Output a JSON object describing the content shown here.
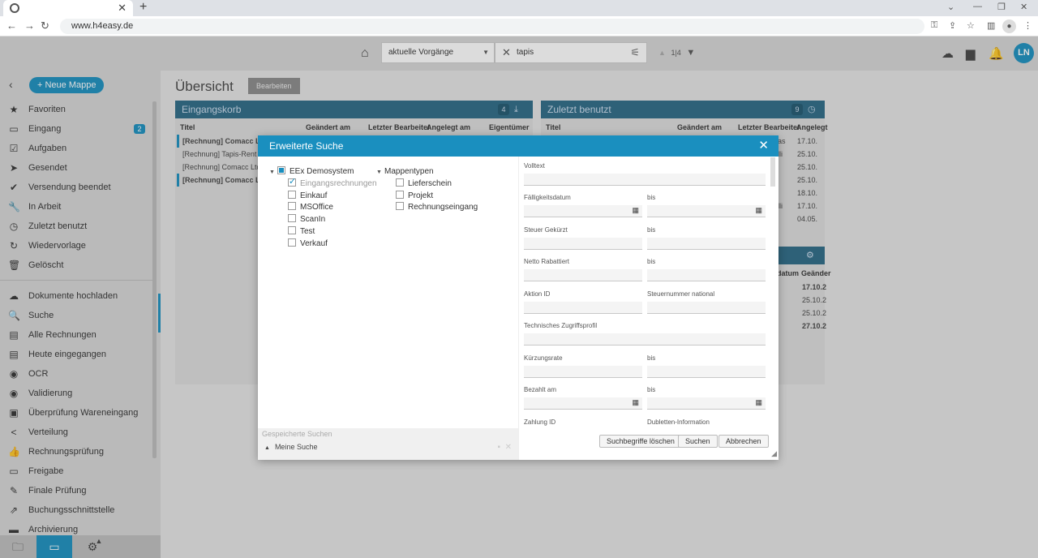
{
  "browser": {
    "tab_close": "✕",
    "new_tab": "+",
    "url": "www.h4easy.de"
  },
  "header": {
    "scope": "aktuelle Vorgänge",
    "search_value": "tapis",
    "result_counter": "1|4",
    "user_initials": "LN"
  },
  "sidebar": {
    "new_folder": "+ Neue Mappe",
    "items": [
      {
        "label": "Favoriten",
        "icon": "star-icon",
        "glyph": "★"
      },
      {
        "label": "Eingang",
        "icon": "inbox-icon",
        "glyph": "▭",
        "badge": "2"
      },
      {
        "label": "Aufgaben",
        "icon": "checkbox-icon",
        "glyph": "☑"
      },
      {
        "label": "Gesendet",
        "icon": "send-icon",
        "glyph": "➤"
      },
      {
        "label": "Versendung beendet",
        "icon": "done-all-icon",
        "glyph": "✔"
      },
      {
        "label": "In Arbeit",
        "icon": "wrench-icon",
        "glyph": "🔧"
      },
      {
        "label": "Zuletzt benutzt",
        "icon": "clock-icon",
        "glyph": "◷"
      },
      {
        "label": "Wiedervorlage",
        "icon": "refresh-icon",
        "glyph": "↻"
      },
      {
        "label": "Gelöscht",
        "icon": "trash-icon",
        "glyph": "🗑"
      },
      {
        "label": "Dokumente hochladen",
        "icon": "cloud-upload-icon",
        "glyph": "☁"
      },
      {
        "label": "Suche",
        "icon": "search-icon",
        "glyph": "🔍"
      },
      {
        "label": "Alle Rechnungen",
        "icon": "list-icon",
        "glyph": "▤"
      },
      {
        "label": "Heute eingegangen",
        "icon": "list-icon",
        "glyph": "▤"
      },
      {
        "label": "OCR",
        "icon": "eye-icon",
        "glyph": "◉"
      },
      {
        "label": "Validierung",
        "icon": "eye-icon",
        "glyph": "◉"
      },
      {
        "label": "Überprüfung Wareneingang",
        "icon": "archive-icon",
        "glyph": "▣"
      },
      {
        "label": "Verteilung",
        "icon": "share-icon",
        "glyph": "<"
      },
      {
        "label": "Rechnungsprüfung",
        "icon": "thumbs-up-icon",
        "glyph": "👍"
      },
      {
        "label": "Freigabe",
        "icon": "card-icon",
        "glyph": "▭"
      },
      {
        "label": "Finale Prüfung",
        "icon": "pen-icon",
        "glyph": "✎"
      },
      {
        "label": "Buchungsschnittstelle",
        "icon": "export-icon",
        "glyph": "⇗"
      },
      {
        "label": "Archivierung",
        "icon": "archive-icon",
        "glyph": "▬"
      }
    ]
  },
  "main": {
    "title": "Übersicht",
    "edit_label": "Bearbeiten",
    "inbox": {
      "title": "Eingangskorb",
      "count": "4",
      "columns": [
        "Titel",
        "Geändert am",
        "Letzter Bearbeiter",
        "Angelegt am",
        "Eigentümer"
      ],
      "rows": [
        "[Rechnung] Comacc Ltd",
        "[Rechnung] Tapis-Rent G",
        "[Rechnung] Comacc Ltd",
        "[Rechnung] Comacc Ltd"
      ]
    },
    "recent": {
      "title": "Zuletzt benutzt",
      "count": "9",
      "columns": [
        "Titel",
        "Geändert am",
        "Letzter Bearbeiter",
        "Angelegt"
      ],
      "dates": [
        "17.10.",
        "25.10.",
        "25.10.",
        "25.10.",
        "18.10.",
        "17.10.",
        "04.05."
      ],
      "editors": [
        "as",
        "lli",
        "",
        "",
        "",
        "lli",
        ""
      ]
    },
    "third": {
      "columns": [
        "datum",
        "Geänder"
      ],
      "dates": [
        "17.10.2",
        "25.10.2",
        "25.10.2",
        "27.10.2"
      ]
    }
  },
  "modal": {
    "title": "Erweiterte Suche",
    "tree": {
      "root": "EEx Demosystem",
      "children": [
        {
          "label": "Eingangsrechnungen",
          "checked": true
        },
        {
          "label": "Einkauf"
        },
        {
          "label": "MSOffice"
        },
        {
          "label": "ScanIn"
        },
        {
          "label": "Test"
        },
        {
          "label": "Verkauf"
        }
      ],
      "mappentypen": "Mappentypen",
      "mappentypen_children": [
        "Lieferschein",
        "Projekt",
        "Rechnungseingang"
      ]
    },
    "saved": {
      "title": "Gespeicherte Suchen",
      "item": "Meine Suche"
    },
    "fields": {
      "volltext": "Volltext",
      "faelligkeit": "Fälligkeitsdatum",
      "bis": "bis",
      "steuer_gekuerzt": "Steuer Gekürzt",
      "netto_rabattiert": "Netto Rabattiert",
      "aktion_id": "Aktion ID",
      "steuernummer": "Steuernummer national",
      "zugriffsprofil": "Technisches Zugriffsprofil",
      "kuerzungsrate": "Kürzungsrate",
      "bezahlt_am": "Bezahlt am",
      "zahlung_id": "Zahlung ID",
      "dubletten": "Dubletten-Information"
    },
    "buttons": {
      "clear": "Suchbegriffe löschen",
      "search": "Suchen",
      "cancel": "Abbrechen"
    }
  }
}
